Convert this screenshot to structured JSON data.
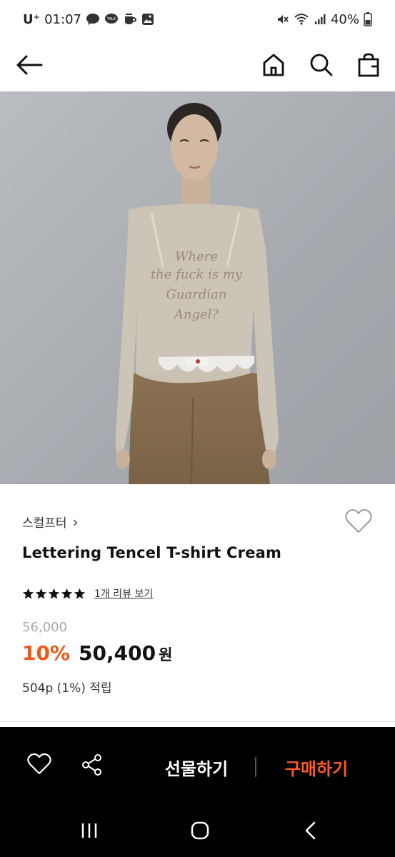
{
  "status_bar": {
    "carrier": "U⁺",
    "time": "01:07",
    "battery": "40%"
  },
  "icons": {
    "back": "arrow-left-icon",
    "home": "home-icon",
    "search": "search-icon",
    "cart": "shopping-bag-icon",
    "wish": "heart-outline-icon",
    "share": "share-icon"
  },
  "product": {
    "brand": "스컬프터",
    "brand_chevron": "›",
    "title": "Lettering Tencel T-shirt Cream",
    "rating": {
      "stars": 5,
      "max": 5,
      "review_link": "1개 리뷰 보기"
    },
    "original_price": "56,000",
    "discount": "10%",
    "sale_price": "50,400",
    "currency": "원",
    "points": "504p (1%) 적립",
    "image_lettering": "Where the fuck is my Guardian Angel?"
  },
  "actions": {
    "gift_label": "선물하기",
    "buy_label": "구매하기"
  },
  "colors": {
    "accent": "#ee5a1a",
    "action_bar": "#000000"
  }
}
